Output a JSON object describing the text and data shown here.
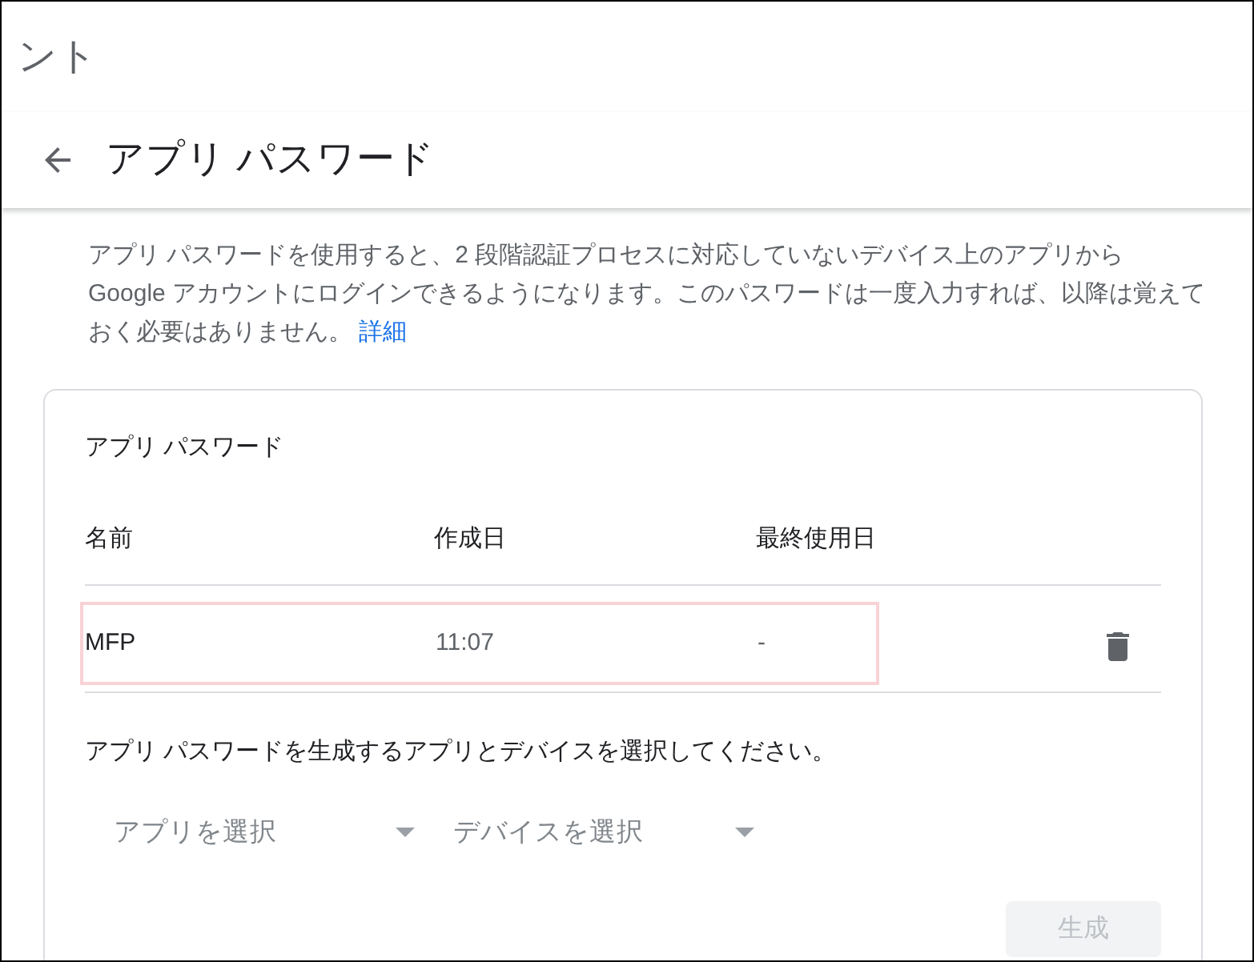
{
  "top_heading": {
    "text": "ント"
  },
  "header": {
    "title": "アプリ パスワード"
  },
  "description": {
    "lines": [
      "アプリ パスワードを使用すると、2 段階認証プロセスに対応していないデバイス上のアプリから",
      "Google アカウントにログインできるようになります。このパスワードは一度入力すれば、以降は覚えて",
      "おく必要はありません。"
    ],
    "link": "詳細"
  },
  "card": {
    "title": "アプリ パスワード",
    "columns": [
      "名前",
      "作成日",
      "最終使用日"
    ],
    "rows": [
      {
        "cells": [
          "MFP",
          "11:07",
          "-"
        ],
        "highlighted": true
      }
    ],
    "instruction": "アプリ パスワードを生成するアプリとデバイスを選択してください。",
    "selects": [
      {
        "placeholder": "アプリを選択"
      },
      {
        "placeholder": "デバイスを選択"
      }
    ],
    "generate_button": {
      "label": "生成",
      "disabled": true
    }
  }
}
